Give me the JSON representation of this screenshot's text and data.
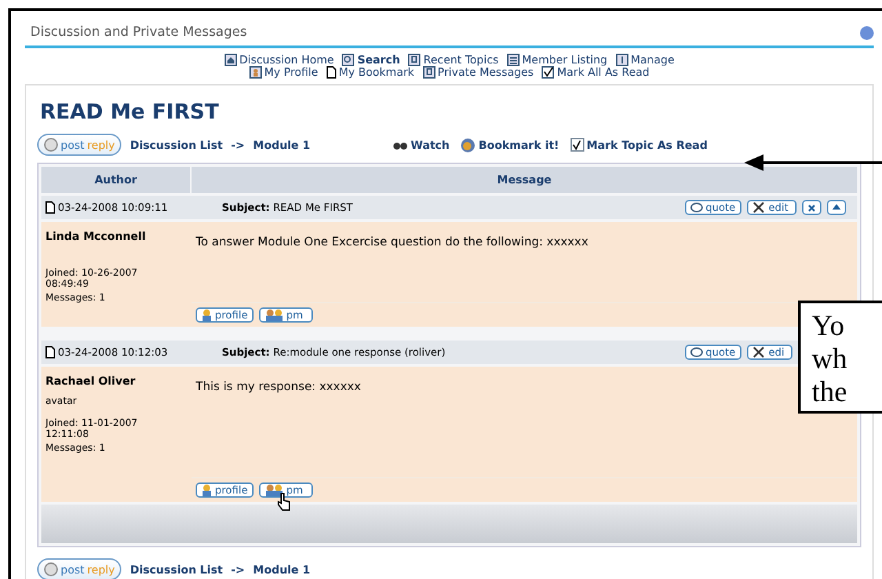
{
  "header": {
    "title": "Discussion and Private Messages"
  },
  "nav": [
    [
      {
        "label": "Discussion Home",
        "kind": "home",
        "emphasized": false
      },
      {
        "label": "Search",
        "kind": "search",
        "emphasized": true
      },
      {
        "label": "Recent Topics",
        "kind": "doc",
        "emphasized": false
      },
      {
        "label": "Member Listing",
        "kind": "list",
        "emphasized": false
      },
      {
        "label": "Manage",
        "kind": "info",
        "emphasized": false
      }
    ],
    [
      {
        "label": "My Profile",
        "kind": "person",
        "emphasized": false
      },
      {
        "label": "My Bookmark",
        "kind": "page",
        "emphasized": false
      },
      {
        "label": "Private Messages",
        "kind": "doc",
        "emphasized": false
      },
      {
        "label": "Mark All As Read",
        "kind": "check",
        "emphasized": false
      }
    ]
  ],
  "topic": {
    "title": "READ Me FIRST"
  },
  "toolbar": {
    "post_button": {
      "left": "post",
      "right": "reply"
    },
    "breadcrumb": [
      "Discussion List",
      "Module 1"
    ],
    "separator": "->",
    "watch": "Watch",
    "bookmark": "Bookmark it!",
    "mark_read": {
      "label": "Mark Topic As Read",
      "checked": true
    }
  },
  "table": {
    "columns": [
      "Author",
      "Message"
    ],
    "posts": [
      {
        "date": "03-24-2008 10:09:11",
        "subject_label": "Subject:",
        "subject": "READ Me FIRST",
        "actions": [
          {
            "kind": "quote",
            "label": "quote"
          },
          {
            "kind": "edit",
            "label": "edit"
          },
          {
            "kind": "delete"
          },
          {
            "kind": "top"
          }
        ],
        "author": "Linda Mcconnell",
        "joined": "Joined: 10-26-2007 08:49:49",
        "messages": "Messages: 1",
        "body": "To answer Module One Excercise question do the following: xxxxxx",
        "profile": "profile",
        "pm": "pm",
        "pointer": false
      },
      {
        "date": "03-24-2008 10:12:03",
        "subject_label": "Subject:",
        "subject": "Re:module one response (roliver)",
        "actions": [
          {
            "kind": "quote",
            "label": "quote"
          },
          {
            "kind": "edit",
            "label": "edi"
          }
        ],
        "author": "Rachael Oliver",
        "avatar": "avatar",
        "joined": "Joined: 11-01-2007 12:11:08",
        "messages": "Messages: 1",
        "body": "This is my response: xxxxxx",
        "profile": "profile",
        "pm": "pm",
        "pointer": true
      }
    ]
  },
  "bottom_toolbar": {
    "post_button": {
      "left": "post",
      "right": "reply"
    },
    "breadcrumb": [
      "Discussion List",
      "Module 1"
    ],
    "separator": "->"
  },
  "callout": {
    "lines": [
      "Yo",
      "wh",
      "the"
    ]
  }
}
